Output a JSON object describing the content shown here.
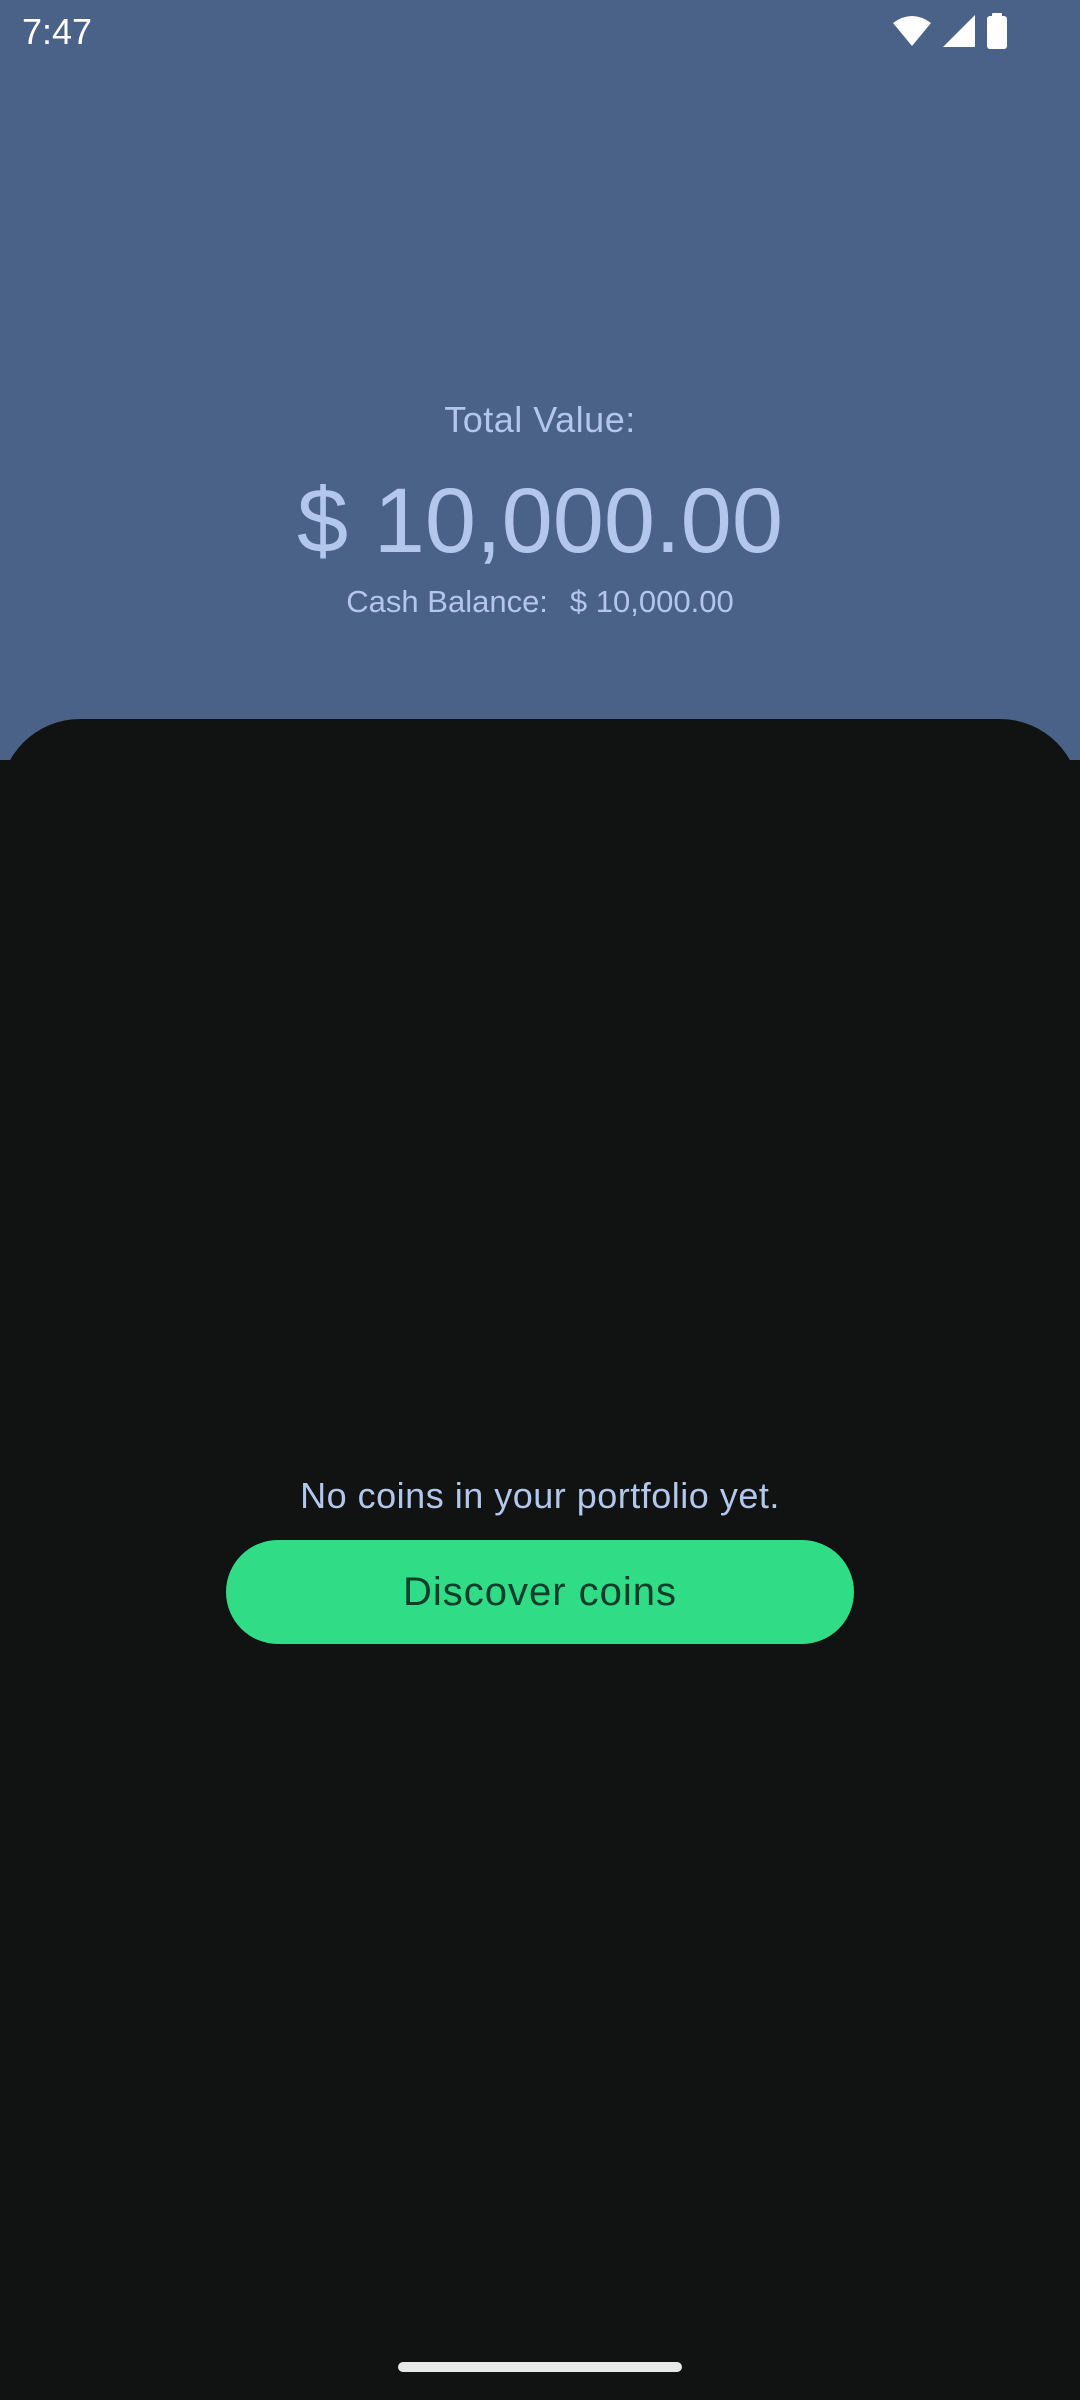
{
  "status_bar": {
    "time": "7:47",
    "icons": [
      "wifi-icon",
      "signal-icon",
      "battery-icon"
    ]
  },
  "portfolio": {
    "total_label": "Total Value:",
    "total_value": "$ 10,000.00",
    "cash_label": "Cash Balance:",
    "cash_value": "$ 10,000.00"
  },
  "empty_state": {
    "message": "No coins in your portfolio yet.",
    "button_label": "Discover coins"
  },
  "colors": {
    "header_background": "#4a6287",
    "sheet_background": "#111313",
    "text_accent": "#b3c6ec",
    "button_background": "#31dc86",
    "button_text": "#123c2b"
  }
}
